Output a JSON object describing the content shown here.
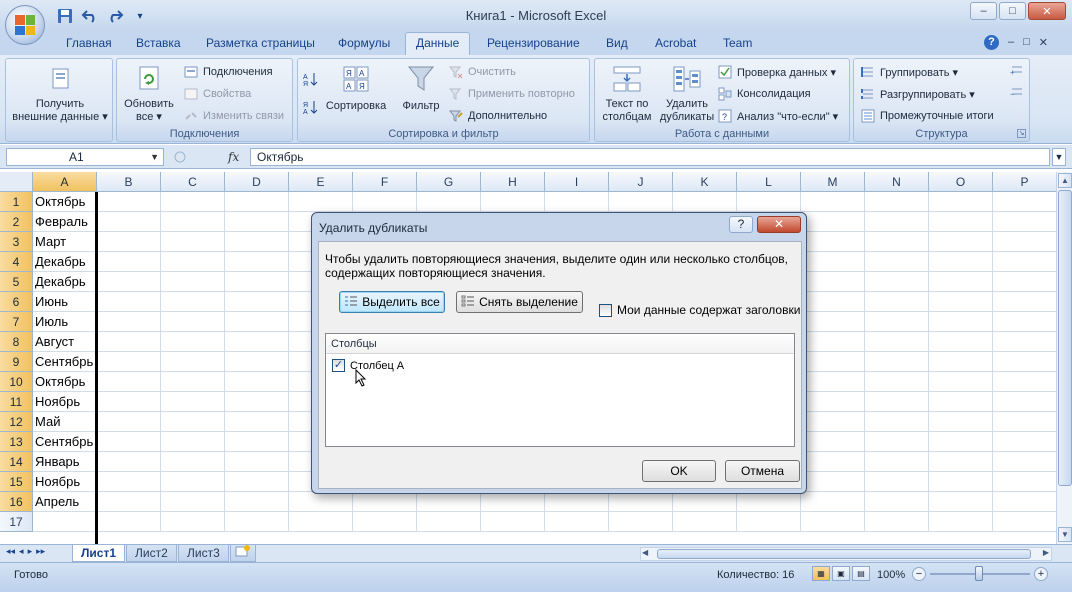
{
  "window": {
    "title": "Книга1 - Microsoft Excel",
    "minimize": "–",
    "maximize": "□",
    "close": "✕"
  },
  "qat": {
    "save_icon": "save-icon",
    "undo_icon": "undo-icon",
    "redo_icon": "redo-icon",
    "customize": "▾"
  },
  "tabs": [
    {
      "label": "Главная"
    },
    {
      "label": "Вставка"
    },
    {
      "label": "Разметка страницы"
    },
    {
      "label": "Формулы"
    },
    {
      "label": "Данные",
      "active": true
    },
    {
      "label": "Рецензирование"
    },
    {
      "label": "Вид"
    },
    {
      "label": "Acrobat"
    },
    {
      "label": "Team"
    }
  ],
  "ribbon": {
    "get_external": {
      "line1": "Получить",
      "line2": "внешние данные ▾"
    },
    "refresh_all": {
      "line1": "Обновить",
      "line2": "все ▾"
    },
    "connections": {
      "label": "Подключения"
    },
    "properties": {
      "label": "Свойства"
    },
    "edit_links": {
      "label": "Изменить связи"
    },
    "connections_group": "Подключения",
    "sort_az": "А↓Я",
    "sort": {
      "label": "Сортировка"
    },
    "filter": {
      "label": "Фильтр"
    },
    "clear": {
      "label": "Очистить"
    },
    "reapply": {
      "label": "Применить повторно"
    },
    "advanced": {
      "label": "Дополнительно"
    },
    "sort_filter_group": "Сортировка и фильтр",
    "text_to_columns": {
      "line1": "Текст по",
      "line2": "столбцам"
    },
    "remove_duplicates": {
      "line1": "Удалить",
      "line2": "дубликаты"
    },
    "data_validation": {
      "label": "Проверка данных ▾"
    },
    "consolidate": {
      "label": "Консолидация"
    },
    "what_if": {
      "label": "Анализ \"что-если\" ▾"
    },
    "data_tools_group": "Работа с данными",
    "group": {
      "label": "Группировать ▾"
    },
    "ungroup": {
      "label": "Разгруппировать ▾"
    },
    "subtotal": {
      "label": "Промежуточные итоги"
    },
    "outline_group": "Структура"
  },
  "formula_bar": {
    "name_box": "A1",
    "fx": "fx",
    "value": "Октябрь"
  },
  "columns": [
    "A",
    "B",
    "C",
    "D",
    "E",
    "F",
    "G",
    "H",
    "I",
    "J",
    "K",
    "L",
    "M",
    "N",
    "O",
    "P"
  ],
  "rows": [
    "1",
    "2",
    "3",
    "4",
    "5",
    "6",
    "7",
    "8",
    "9",
    "10",
    "11",
    "12",
    "13",
    "14",
    "15",
    "16",
    "17"
  ],
  "cells_a": [
    "Октябрь",
    "Февраль",
    "Март",
    "Декабрь",
    "Декабрь",
    "Июнь",
    "Июль",
    "Август",
    "Сентябрь",
    "Октябрь",
    "Ноябрь",
    "Май",
    "Сентябрь",
    "Январь",
    "Ноябрь",
    "Апрель",
    ""
  ],
  "sheets": [
    {
      "label": "Лист1",
      "active": true
    },
    {
      "label": "Лист2"
    },
    {
      "label": "Лист3"
    }
  ],
  "sheet_nav": [
    "◂◂",
    "◂",
    "▸",
    "▸▸"
  ],
  "status": {
    "ready": "Готово",
    "count": "Количество: 16",
    "zoom": "100%",
    "zoom_minus": "−",
    "zoom_plus": "+"
  },
  "dialog": {
    "title": "Удалить дубликаты",
    "help": "?",
    "close": "✕",
    "description": "Чтобы удалить повторяющиеся значения, выделите один или несколько столбцов, содержащих повторяющиеся значения.",
    "select_all": "Выделить все",
    "unselect_all": "Снять выделение",
    "headers_checkbox": "Мои данные содержат заголовки",
    "headers_checked": false,
    "columns_header": "Столбцы",
    "column_item": "Столбец A",
    "column_item_checked": true,
    "ok": "OK",
    "cancel": "Отмена"
  },
  "colors": {
    "accent_blue": "#15428b",
    "ribbon_bg": "#dae6f4",
    "selection_header": "#f1c15f"
  }
}
